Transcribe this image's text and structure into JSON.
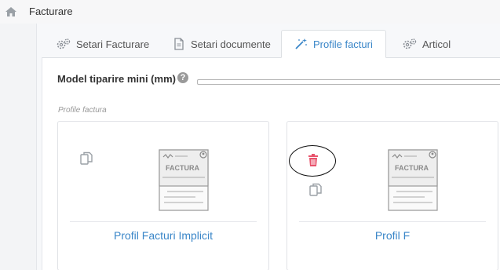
{
  "breadcrumb": {
    "home_icon": "home-icon",
    "title": "Facturare"
  },
  "tabs": [
    {
      "label": "Setari Facturare",
      "icon": "gears-icon",
      "active": false
    },
    {
      "label": "Setari documente",
      "icon": "document-icon",
      "active": false
    },
    {
      "label": "Profile facturi",
      "icon": "magic-wand-icon",
      "active": true
    },
    {
      "label": "Articol",
      "icon": "gears-icon",
      "active": false
    }
  ],
  "model": {
    "label": "Model tiparire mini (mm)",
    "help_icon": "question-circle-icon",
    "value": ""
  },
  "section_label": "Profile factura",
  "invoice_image_text": "FACTURA",
  "profiles": [
    {
      "name": "Profil Facturi Implicit"
    },
    {
      "name": "Profil F"
    }
  ],
  "colors": {
    "accent": "#3a86c8",
    "delete": "#e8536c"
  }
}
